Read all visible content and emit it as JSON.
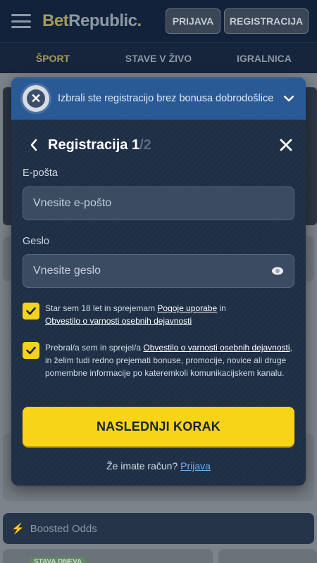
{
  "header": {
    "logo_bet": "Bet",
    "logo_rest": "Republic",
    "logo_dot": ".",
    "login_label": "PRIJAVA",
    "register_label": "REGISTRACIJA"
  },
  "nav": {
    "tabs": [
      {
        "label": "ŠPORT",
        "active": true
      },
      {
        "label": "STAVE V ŽIVO",
        "active": false
      },
      {
        "label": "IGRALNICA",
        "active": false
      }
    ]
  },
  "background": {
    "boosted_label": "Boosted Odds",
    "tag_label": "STAVA DNEVA"
  },
  "modal": {
    "bonus_banner_text": "Izbrali ste registracijo brez bonusa dobrodošlice",
    "title": "Registracija 1",
    "title_total": "/2",
    "email": {
      "label": "E-pošta",
      "placeholder": "Vnesite e-pošto",
      "value": ""
    },
    "password": {
      "label": "Geslo",
      "placeholder": "Vnesite geslo",
      "value": ""
    },
    "checkbox_age": {
      "checked": true,
      "text_before": "Star sem 18 let in sprejemam ",
      "link_terms": "Pogoje uporabe",
      "text_middle": " in ",
      "link_privacy": "Obvestilo o varnosti osebnih dejavnosti"
    },
    "checkbox_marketing": {
      "checked": true,
      "text_before": "Prebral/a sem in sprejel/a ",
      "link_privacy": "Obvestilo o varnosti osebnih dejavnosti",
      "text_after": ", in želim tudi redno prejemati bonuse, promocije, novice ali druge pomembne informacije po kateremkoli komunikacijskem kanalu."
    },
    "next_button_label": "NASLEDNJI KORAK",
    "account_question": "Že imate račun? ",
    "account_link": "Prijava"
  },
  "colors": {
    "accent_yellow": "#f7d418",
    "banner_blue": "#2a5a96",
    "modal_bg": "#1f2f45",
    "link_blue": "#6ab0ef"
  },
  "icons": {
    "menu": "hamburger-menu-icon",
    "bonus": "no-bonus-x-icon",
    "expand": "chevron-down-icon",
    "back": "chevron-left-icon",
    "close": "close-icon",
    "password_toggle": "eye-icon",
    "check": "checkmark-icon",
    "boosted": "lightning-bolt-icon"
  }
}
